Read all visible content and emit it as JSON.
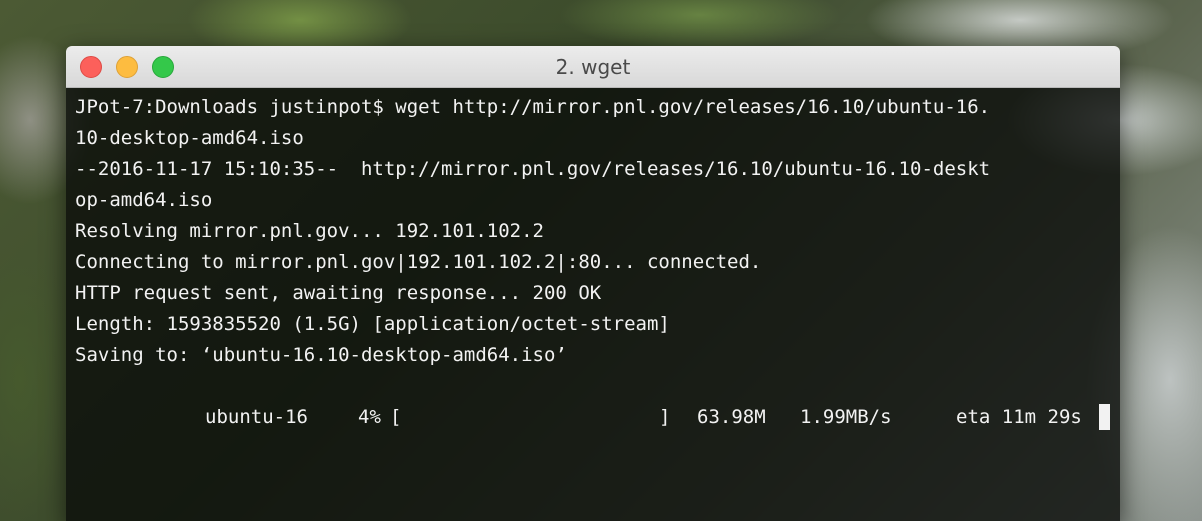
{
  "window": {
    "title": "2. wget"
  },
  "terminal": {
    "lines": [
      "JPot-7:Downloads justinpot$ wget http://mirror.pnl.gov/releases/16.10/ubuntu-16.",
      "10-desktop-amd64.iso",
      "--2016-11-17 15:10:35--  http://mirror.pnl.gov/releases/16.10/ubuntu-16.10-deskt",
      "op-amd64.iso",
      "Resolving mirror.pnl.gov... 192.101.102.2",
      "Connecting to mirror.pnl.gov|192.101.102.2|:80... connected.",
      "HTTP request sent, awaiting response... 200 OK",
      "Length: 1593835520 (1.5G) [application/octet-stream]",
      "Saving to: ‘ubuntu-16.10-desktop-amd64.iso’"
    ],
    "progress": {
      "file": "ubuntu-16",
      "percent": "4%",
      "bar_open": "[",
      "bar_close": "]",
      "downloaded": "63.98M",
      "rate": "1.99MB/s",
      "eta": "eta 11m 29s"
    }
  }
}
